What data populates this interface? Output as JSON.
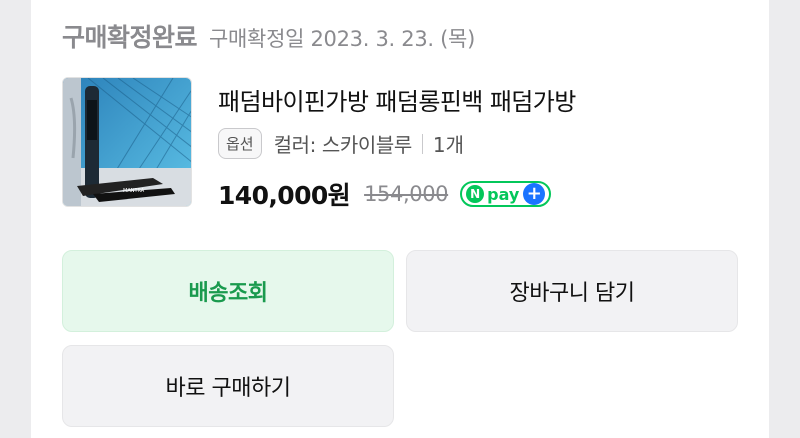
{
  "order": {
    "status": "구매확정완료",
    "confirm_date": "구매확정일 2023. 3. 23. (목)"
  },
  "product": {
    "name": "패덤바이핀가방 패덤롱핀백 패덤가방",
    "option_badge": "옵션",
    "option_value": "컬러: 스카이블루",
    "quantity": "1개",
    "price": "140,000원",
    "original_price": "154,000",
    "image_icon": "product-photo-pool-fin-bag"
  },
  "npay": {
    "n": "N",
    "label": "pay",
    "plus": "+",
    "color": "#03c75a"
  },
  "buttons": {
    "track": "배송조회",
    "cart": "장바구니 담기",
    "buy": "바로 구매하기"
  },
  "colors": {
    "track_bg": "#e6f8ec",
    "track_text": "#1a9a4e",
    "neutral_bg": "#f2f2f4",
    "muted_text": "#8a8a8e"
  }
}
